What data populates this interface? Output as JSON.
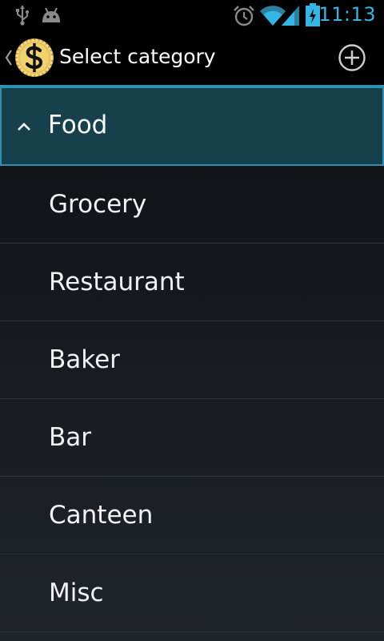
{
  "status_bar": {
    "time": "11:13",
    "left_icons": [
      "usb-icon",
      "android-debug-icon"
    ],
    "right_icons": [
      "alarm-icon",
      "wifi-icon",
      "signal-icon",
      "battery-charging-icon"
    ],
    "accent_color": "#33b5e5"
  },
  "action_bar": {
    "title": "Select category",
    "up_icon": "chevron-left-icon",
    "logo_icon": "dollar-coin-icon",
    "action_icon": "add-circle-icon",
    "divider_color": "#2e8fb3"
  },
  "category_list": {
    "group": {
      "label": "Food",
      "expanded": true,
      "chevron_icon": "chevron-up-icon",
      "highlight_color": "#17404d"
    },
    "items": [
      {
        "label": "Grocery"
      },
      {
        "label": "Restaurant"
      },
      {
        "label": "Baker"
      },
      {
        "label": "Bar"
      },
      {
        "label": "Canteen"
      },
      {
        "label": "Misc"
      }
    ]
  }
}
